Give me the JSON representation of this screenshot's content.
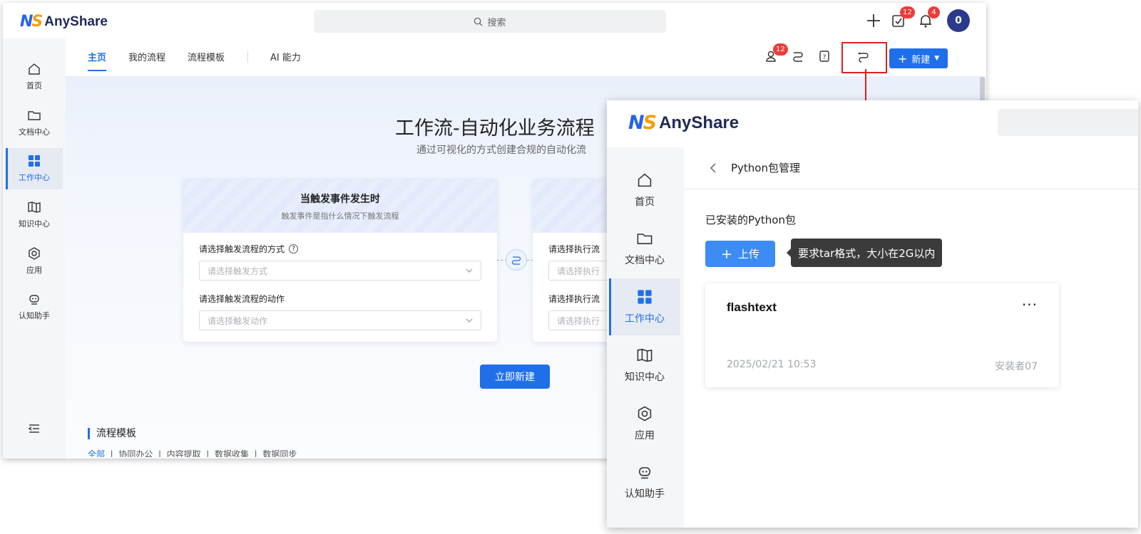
{
  "back": {
    "search_placeholder": "搜索",
    "task_badge": "12",
    "notify_badge": "4",
    "avatar": "0",
    "sidebar": {
      "items": [
        {
          "label": "首页",
          "icon": "home-icon"
        },
        {
          "label": "文档中心",
          "icon": "folder-icon"
        },
        {
          "label": "工作中心",
          "icon": "grid-icon"
        },
        {
          "label": "知识中心",
          "icon": "map-icon"
        },
        {
          "label": "应用",
          "icon": "app-icon"
        },
        {
          "label": "认知助手",
          "icon": "robot-icon"
        }
      ],
      "active": "工作中心"
    },
    "tabs": [
      "主页",
      "我的流程",
      "流程模板",
      "AI 能力"
    ],
    "toolbar": {
      "user_badge": "12",
      "new_button": "新建"
    },
    "hero": {
      "title": "工作流-自动化业务流程",
      "subtitle": "通过可视化的方式创建合规的自动化流"
    },
    "trigger_card": {
      "title": "当触发事件发生时",
      "subtitle": "触发事件是指什么情况下触发流程",
      "label1": "请选择触发流程的方式",
      "placeholder1": "请选择触发方式",
      "label2": "请选择触发流程的动作",
      "placeholder2": "请选择触发动作"
    },
    "exec_card": {
      "label1": "请选择执行流",
      "placeholder1": "请选择执行",
      "label2": "请选择执行流",
      "placeholder2": "请选择执行"
    },
    "create_button": "立即新建",
    "section_title": "流程模板",
    "section_tabs": [
      "全部",
      "协同办公",
      "内容提取",
      "数据收集",
      "数据同步"
    ]
  },
  "front": {
    "sidebar": {
      "items": [
        {
          "label": "首页",
          "icon": "home-icon"
        },
        {
          "label": "文档中心",
          "icon": "folder-icon"
        },
        {
          "label": "工作中心",
          "icon": "grid-icon"
        },
        {
          "label": "知识中心",
          "icon": "map-icon"
        },
        {
          "label": "应用",
          "icon": "app-icon"
        },
        {
          "label": "认知助手",
          "icon": "robot-icon"
        }
      ],
      "active": "工作中心"
    },
    "page_title": "Python包管理",
    "installed_label": "已安装的Python包",
    "upload_button": "上传",
    "tooltip": "要求tar格式，大小在2G以内",
    "package": {
      "name": "flashtext",
      "date": "2025/02/21 10:53",
      "owner": "安装者07",
      "more": "···"
    }
  },
  "brand": {
    "name": "AnyShare",
    "accent": "#1f6feb",
    "highlight": "#e02020"
  }
}
